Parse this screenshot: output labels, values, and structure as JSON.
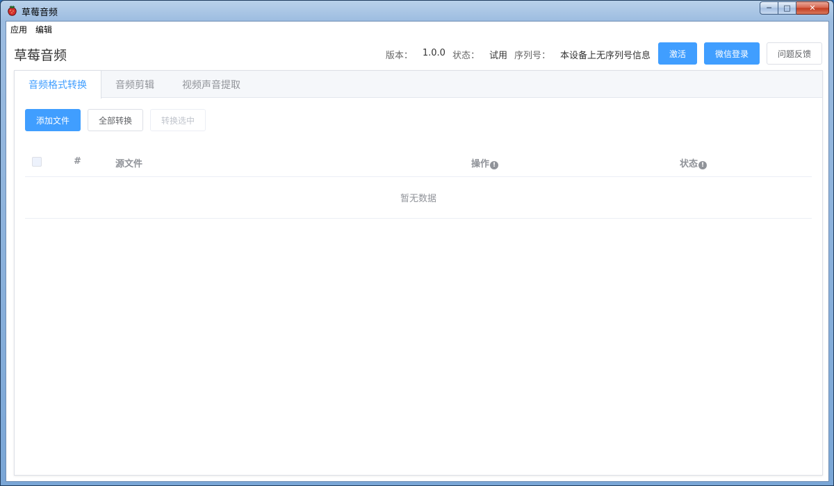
{
  "window": {
    "title": "草莓音频",
    "controls": {
      "minimize": "─",
      "maximize": "□",
      "close": "✕"
    }
  },
  "menubar": {
    "items": [
      "应用",
      "编辑"
    ]
  },
  "header": {
    "app_title": "草莓音频",
    "version_label": "版本：",
    "version_value": "1.0.0",
    "status_label": "状态：",
    "status_value": "试用",
    "serial_label": "序列号：",
    "serial_value": "本设备上无序列号信息",
    "activate_button": "激活",
    "wechat_login_button": "微信登录",
    "feedback_button": "问题反馈"
  },
  "tabs": [
    {
      "label": "音频格式转换",
      "active": true
    },
    {
      "label": "音频剪辑",
      "active": false
    },
    {
      "label": "视频声音提取",
      "active": false
    }
  ],
  "toolbar": {
    "add_file": "添加文件",
    "convert_all": "全部转换",
    "convert_selected": "转换选中"
  },
  "table": {
    "columns": {
      "index": "#",
      "source": "源文件",
      "action": "操作",
      "status": "状态"
    },
    "info_glyph": "!",
    "empty_text": "暂无数据",
    "rows": []
  },
  "colors": {
    "primary": "#409eff",
    "muted": "#909399"
  }
}
